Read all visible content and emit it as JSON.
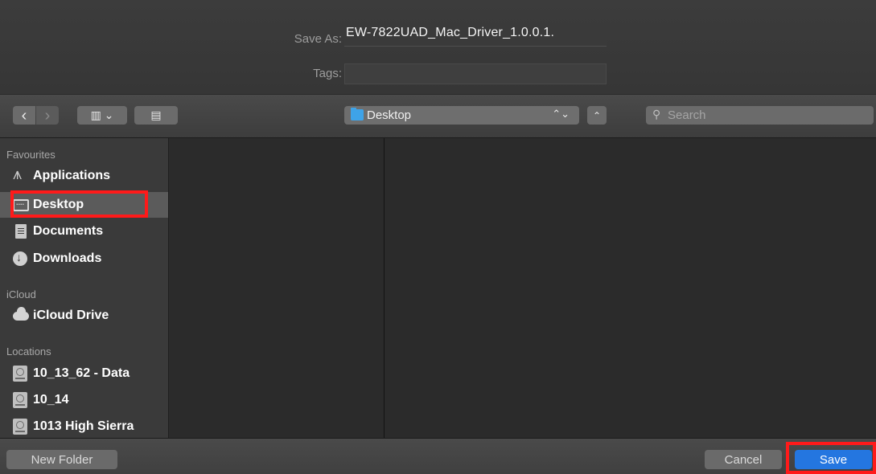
{
  "form": {
    "save_as_label": "Save As:",
    "save_as_value": "EW-7822UAD_Mac_Driver_1.0.0.1.",
    "tags_label": "Tags:",
    "tags_value": ""
  },
  "toolbar": {
    "back_glyph": "‹",
    "forward_glyph": "›",
    "view_glyph": "▥ ⌄",
    "new_folder_glyph": "▤",
    "location": "Desktop",
    "location_arrows": "⌃⌄",
    "expand_glyph": "⌃",
    "search_placeholder": "Search",
    "search_glyph": "⚲"
  },
  "sidebar": {
    "sections": [
      {
        "header": "Favourites",
        "items": [
          {
            "label": "Applications",
            "icon": "applications-icon"
          },
          {
            "label": "Desktop",
            "icon": "desktop-icon",
            "selected": true
          },
          {
            "label": "Documents",
            "icon": "documents-icon"
          },
          {
            "label": "Downloads",
            "icon": "downloads-icon"
          }
        ]
      },
      {
        "header": "iCloud",
        "items": [
          {
            "label": "iCloud Drive",
            "icon": "cloud-icon"
          }
        ]
      },
      {
        "header": "Locations",
        "items": [
          {
            "label": "10_13_62 - Data",
            "icon": "disk-icon"
          },
          {
            "label": "10_14",
            "icon": "disk-icon"
          },
          {
            "label": "1013 High Sierra",
            "icon": "disk-icon"
          }
        ]
      }
    ]
  },
  "footer": {
    "new_folder_label": "New Folder",
    "cancel_label": "Cancel",
    "save_label": "Save"
  },
  "colors": {
    "accent": "#2476e0",
    "highlight": "#ff1a1a",
    "folder": "#3ea3e8"
  }
}
